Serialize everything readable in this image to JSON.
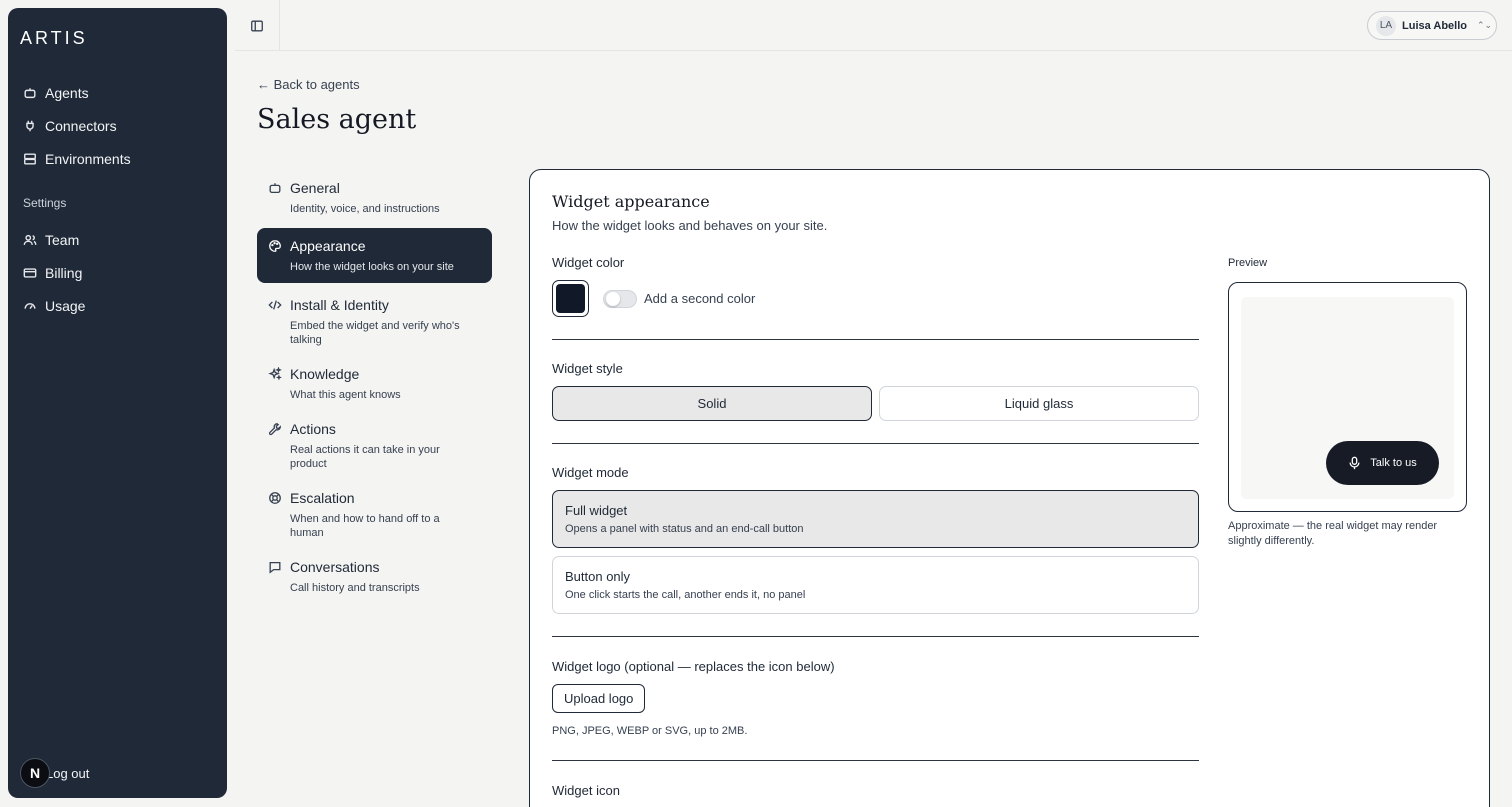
{
  "brand": {
    "logo_text": "ARTIS"
  },
  "sidebar": {
    "items": [
      {
        "label": "Agents",
        "icon": "robot-icon"
      },
      {
        "label": "Connectors",
        "icon": "plug-icon"
      },
      {
        "label": "Environments",
        "icon": "server-icon"
      }
    ],
    "settings_label": "Settings",
    "settings_items": [
      {
        "label": "Team",
        "icon": "users-icon"
      },
      {
        "label": "Billing",
        "icon": "credit-card-icon"
      },
      {
        "label": "Usage",
        "icon": "gauge-icon"
      }
    ],
    "logout_label": "Log out",
    "avatar_letter": "N"
  },
  "topbar": {
    "user_initials": "LA",
    "user_name": "Luisa Abello"
  },
  "page": {
    "back_label": "← Back to agents",
    "title": "Sales agent"
  },
  "subnav": [
    {
      "title": "General",
      "desc": "Identity, voice, and instructions",
      "icon": "robot-icon"
    },
    {
      "title": "Appearance",
      "desc": "How the widget looks on your site",
      "icon": "palette-icon",
      "active": true
    },
    {
      "title": "Install & Identity",
      "desc": "Embed the widget and verify who's talking",
      "icon": "code-icon"
    },
    {
      "title": "Knowledge",
      "desc": "What this agent knows",
      "icon": "sparkles-icon"
    },
    {
      "title": "Actions",
      "desc": "Real actions it can take in your product",
      "icon": "wrench-icon"
    },
    {
      "title": "Escalation",
      "desc": "When and how to hand off to a human",
      "icon": "lifebuoy-icon"
    },
    {
      "title": "Conversations",
      "desc": "Call history and transcripts",
      "icon": "chat-icon"
    }
  ],
  "card": {
    "title": "Widget appearance",
    "subtitle": "How the widget looks and behaves on your site.",
    "color": {
      "label": "Widget color",
      "value": "#111827",
      "second_color_label": "Add a second color",
      "second_color_enabled": false
    },
    "style": {
      "label": "Widget style",
      "options": [
        "Solid",
        "Liquid glass"
      ],
      "selected": "Solid"
    },
    "mode": {
      "label": "Widget mode",
      "options": [
        {
          "title": "Full widget",
          "desc": "Opens a panel with status and an end-call button",
          "selected": true
        },
        {
          "title": "Button only",
          "desc": "One click starts the call, another ends it, no panel",
          "selected": false
        }
      ]
    },
    "logo": {
      "label": "Widget logo (optional — replaces the icon below)",
      "button": "Upload logo",
      "hint": "PNG, JPEG, WEBP or SVG, up to 2MB."
    },
    "icon_section": {
      "label": "Widget icon"
    },
    "preview": {
      "label": "Preview",
      "button_label": "Talk to us",
      "note": "Approximate — the real widget may render slightly differently."
    }
  }
}
